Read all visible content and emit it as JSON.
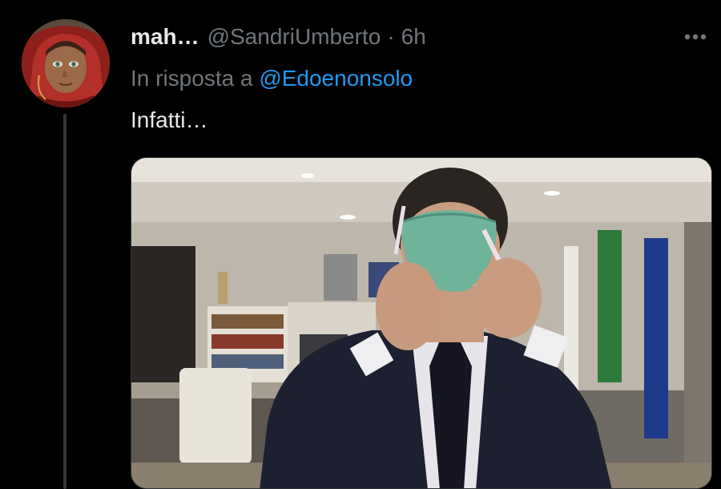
{
  "tweet": {
    "display_name": "mah…",
    "handle": "@SandriUmberto",
    "separator": "·",
    "time": "6h",
    "reply_prefix": "In risposta a",
    "reply_to": "@Edoenonsolo",
    "text": "Infatti…"
  },
  "icons": {
    "more": "more-horizontal-icon"
  },
  "colors": {
    "background": "#000000",
    "primary_text": "#e7e9ea",
    "secondary_text": "#71767b",
    "link": "#1d9bf0",
    "thread_line": "#333639"
  }
}
